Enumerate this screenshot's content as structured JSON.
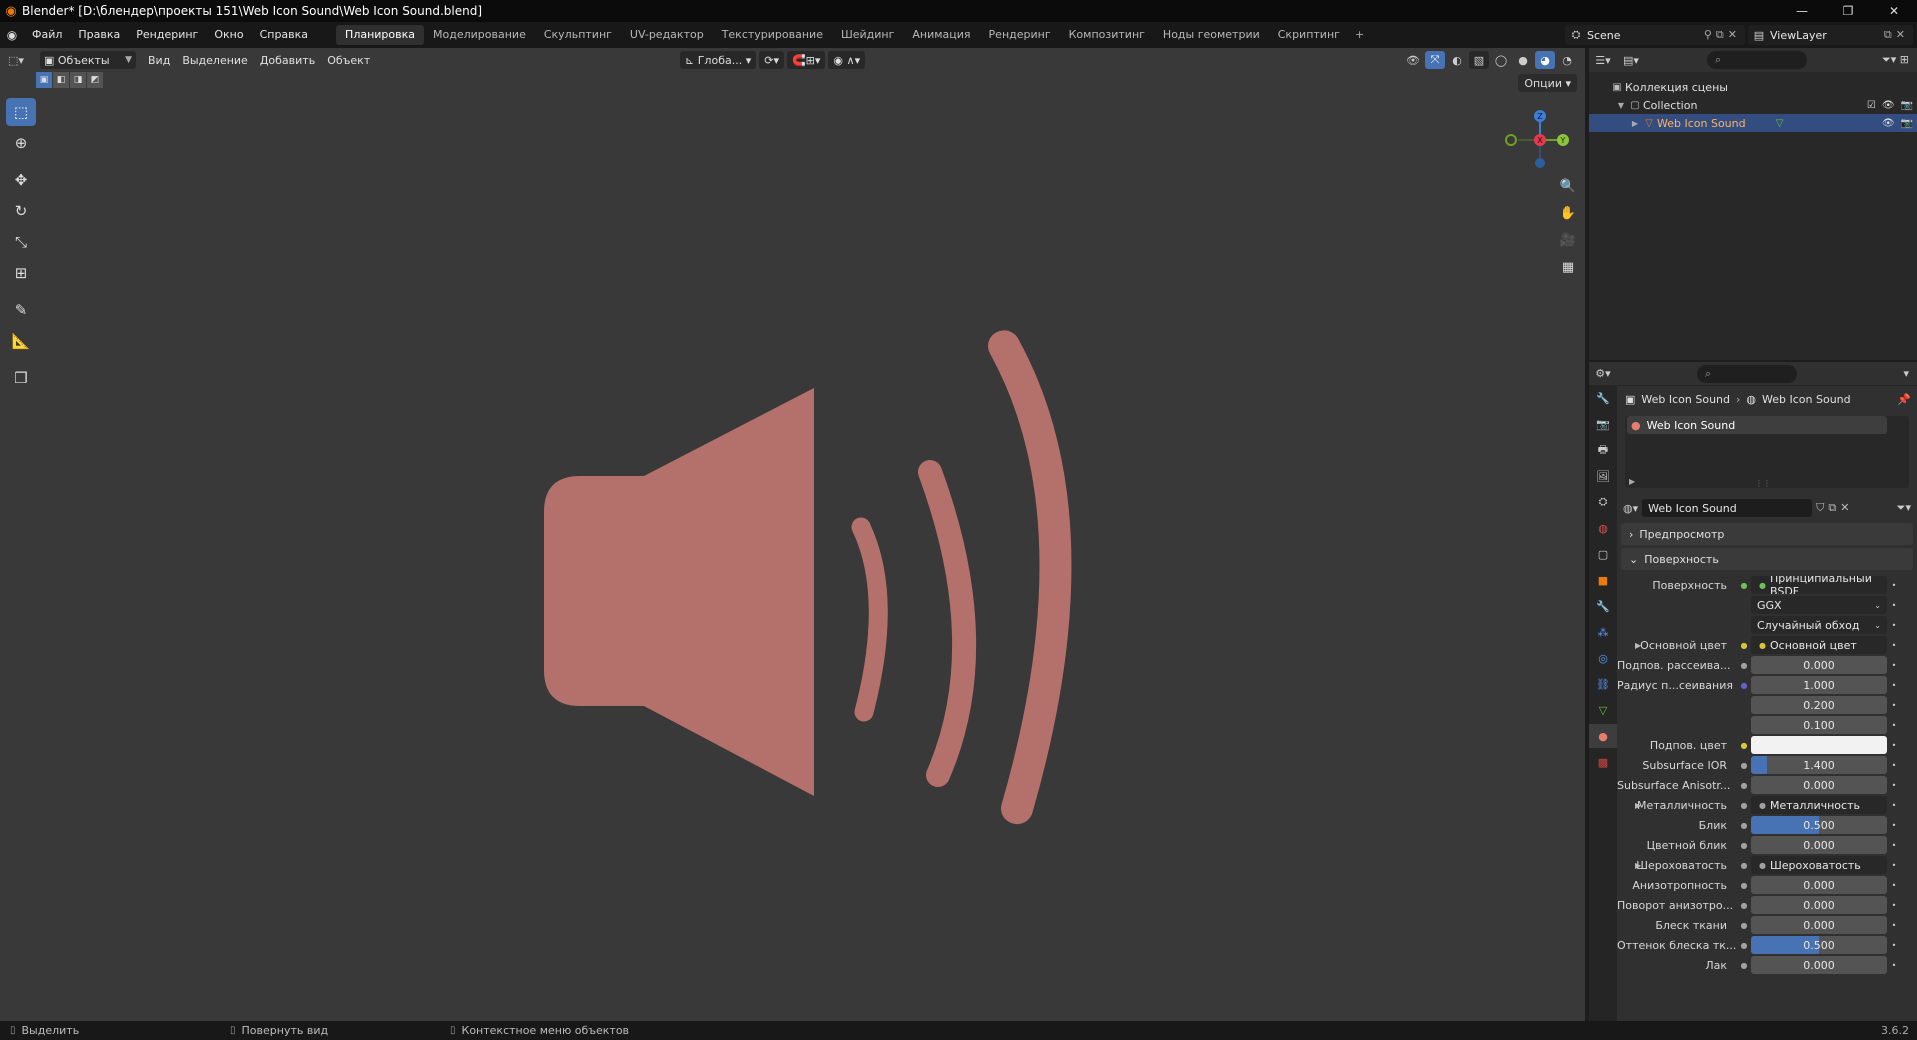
{
  "window": {
    "title": "Blender* [D:\\блендер\\проекты 151\\Web Icon Sound\\Web Icon Sound.blend]",
    "controls": [
      "—",
      "❐",
      "✕"
    ]
  },
  "menu": [
    "Файл",
    "Правка",
    "Рендеринг",
    "Окно",
    "Справка"
  ],
  "workspaces": [
    "Планировка",
    "Моделирование",
    "Скульптинг",
    "UV-редактор",
    "Текстурирование",
    "Шейдинг",
    "Анимация",
    "Рендеринг",
    "Композитинг",
    "Ноды геометрии",
    "Скриптинг"
  ],
  "workspace_add": "+",
  "scene": {
    "label": "Scene"
  },
  "view_layer": {
    "label": "ViewLayer"
  },
  "viewport": {
    "mode": "Объекты",
    "menu": [
      "Вид",
      "Выделение",
      "Добавить",
      "Объект"
    ],
    "orientation": "Глоба...",
    "options": "Опции",
    "gizmo": {
      "x": "X",
      "y": "Y",
      "z": "Z"
    },
    "object_color": "#b4706b",
    "background": "#393939"
  },
  "outliner": {
    "rows": [
      {
        "label": "Коллекция сцены",
        "icon": "scene-collection-icon"
      },
      {
        "label": "Collection",
        "icon": "collection-icon"
      },
      {
        "label": "Web Icon Sound",
        "icon": "object-icon",
        "selected": true
      }
    ]
  },
  "properties": {
    "breadcrumb": {
      "object": "Web Icon Sound",
      "material": "Web Icon Sound"
    },
    "slot": "Web Icon Sound",
    "material_name": "Web Icon Sound",
    "panels": {
      "preview": "Предпросмотр",
      "surface": "Поверхность"
    },
    "rows": [
      {
        "label": "Поверхность",
        "value": "Принципиальный BSDF",
        "kind": "link",
        "socket": "#6fbf5a"
      },
      {
        "label": "",
        "value": "GGX",
        "kind": "select"
      },
      {
        "label": "",
        "value": "Случайный обход",
        "kind": "select"
      },
      {
        "label": "Основной цвет",
        "value": "Основной цвет",
        "kind": "link",
        "socket": "#d8c53a",
        "expand": true
      },
      {
        "label": "Подпов. рассеива...",
        "value": "0.000",
        "kind": "num",
        "socket": "#a0a0a0"
      },
      {
        "label": "Радиус п...сеивания",
        "value": "1.000",
        "kind": "num",
        "socket": "#6363c7"
      },
      {
        "label": "",
        "value": "0.200",
        "kind": "num"
      },
      {
        "label": "",
        "value": "0.100",
        "kind": "num"
      },
      {
        "label": "Подпов. цвет",
        "value": "",
        "kind": "color",
        "socket": "#d8c53a"
      },
      {
        "label": "Subsurface IOR",
        "value": "1.400",
        "kind": "num",
        "socket": "#a0a0a0",
        "fill": 0.12
      },
      {
        "label": "Subsurface Anisotr...",
        "value": "0.000",
        "kind": "num",
        "socket": "#a0a0a0"
      },
      {
        "label": "Металличность",
        "value": "Металличность",
        "kind": "link",
        "socket": "#a0a0a0",
        "expand": true
      },
      {
        "label": "Блик",
        "value": "0.500",
        "kind": "num",
        "socket": "#a0a0a0",
        "fill": 0.5
      },
      {
        "label": "Цветной блик",
        "value": "0.000",
        "kind": "num",
        "socket": "#a0a0a0"
      },
      {
        "label": "Шероховатость",
        "value": "Шероховатость",
        "kind": "link",
        "socket": "#a0a0a0",
        "expand": true
      },
      {
        "label": "Анизотропность",
        "value": "0.000",
        "kind": "num",
        "socket": "#a0a0a0"
      },
      {
        "label": "Поворот анизотро...",
        "value": "0.000",
        "kind": "num",
        "socket": "#a0a0a0"
      },
      {
        "label": "Блеск ткани",
        "value": "0.000",
        "kind": "num",
        "socket": "#a0a0a0"
      },
      {
        "label": "Оттенок блеска тк...",
        "value": "0.500",
        "kind": "num",
        "socket": "#a0a0a0",
        "fill": 0.5
      },
      {
        "label": "Лак",
        "value": "0.000",
        "kind": "num",
        "socket": "#a0a0a0"
      }
    ]
  },
  "status": {
    "hints": [
      "Выделить",
      "Повернуть вид",
      "Контекстное меню объектов"
    ],
    "version": "3.6.2"
  }
}
